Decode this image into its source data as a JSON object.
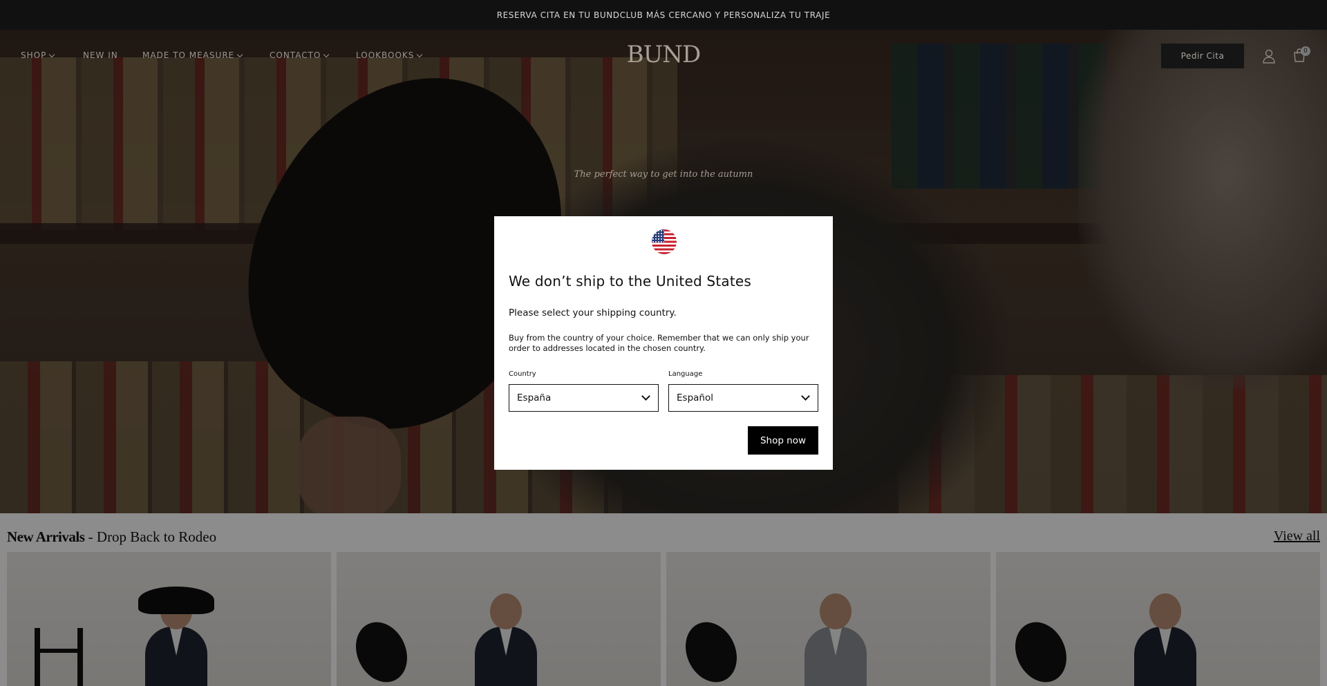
{
  "announcement": "RESERVA CITA EN TU BUNDCLUB MÁS CERCANO Y PERSONALIZA TU TRAJE",
  "nav": {
    "items": [
      {
        "label": "SHOP",
        "dropdown": true
      },
      {
        "label": "NEW IN",
        "dropdown": false
      },
      {
        "label": "MADE TO MEASURE",
        "dropdown": true
      },
      {
        "label": "CONTACTO",
        "dropdown": true
      },
      {
        "label": "LOOKBOOKS",
        "dropdown": true
      }
    ],
    "logo": "BUND",
    "cita_button": "Pedir Cita",
    "cart_count": "0",
    "icons": [
      "user-icon",
      "cart-icon"
    ]
  },
  "hero": {
    "tagline": "The perfect way to get into the autumn"
  },
  "modal": {
    "flag_icon": "us-flag-icon",
    "title": "We don’t ship to the United States",
    "subtitle": "Please select your shipping country.",
    "description": "Buy from the country of your choice. Remember that we can only ship your order to addresses located in the chosen country.",
    "country_label": "Country",
    "country_value": "España",
    "language_label": "Language",
    "language_value": "Español",
    "shop_button": "Shop now"
  },
  "products": {
    "title_bold": "New Arrivals",
    "title_rest": " - Drop Back to Rodeo",
    "view_all": "View all"
  },
  "colors": {
    "announcement_bg": "#111111",
    "overlay": "rgba(0,0,0,0.45)",
    "button_black": "#000000"
  }
}
